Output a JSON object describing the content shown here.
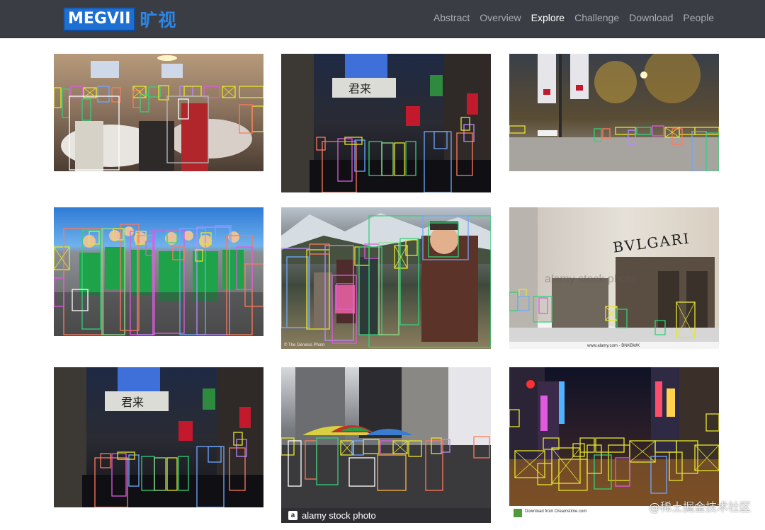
{
  "brand": {
    "logo_text": "MEGVII",
    "logo_cn": "旷视"
  },
  "nav": {
    "items": [
      {
        "label": "Abstract",
        "active": false
      },
      {
        "label": "Overview",
        "active": false
      },
      {
        "label": "Explore",
        "active": true
      },
      {
        "label": "Challenge",
        "active": false
      },
      {
        "label": "Download",
        "active": false
      },
      {
        "label": "People",
        "active": false
      }
    ]
  },
  "gallery": {
    "images": [
      {
        "scene": "banquet-hall",
        "boxes": 22
      },
      {
        "scene": "night-street-signs",
        "boxes": 14
      },
      {
        "scene": "boulevard-night-lights",
        "boxes": 16
      },
      {
        "scene": "group-green-shirts",
        "boxes": 24
      },
      {
        "scene": "mountain-group",
        "boxes": 15
      },
      {
        "scene": "bulgari-storefront",
        "boxes": 8
      },
      {
        "scene": "night-street-signs-2",
        "boxes": 14
      },
      {
        "scene": "market-umbrellas",
        "boxes": 18
      },
      {
        "scene": "neon-street-crossing",
        "boxes": 20
      }
    ],
    "image_texts": {
      "sign_a": "君来",
      "store_name": "BVLGARI",
      "alamy_watermark": "alamy stock photo",
      "alamy_small": "www.alamy.com - BNKBWK",
      "alamy_bar": "alamy stock photo",
      "alamy_icon": "a",
      "dreams_credit": "Download from Dreamstime.com",
      "genesis_credit": "© The Genesis Photo"
    }
  },
  "footer_watermark": "@稀土掘金技术社区",
  "colors": {
    "navbar_bg": "#3a3e44",
    "nav_text": "#a9adb3",
    "nav_active": "#ffffff",
    "box_palette": [
      "#e6e62b",
      "#33d17a",
      "#e05ae0",
      "#6fa8ff",
      "#ff7a5c",
      "#8fe08f",
      "#b98cff",
      "#ffb347"
    ]
  }
}
